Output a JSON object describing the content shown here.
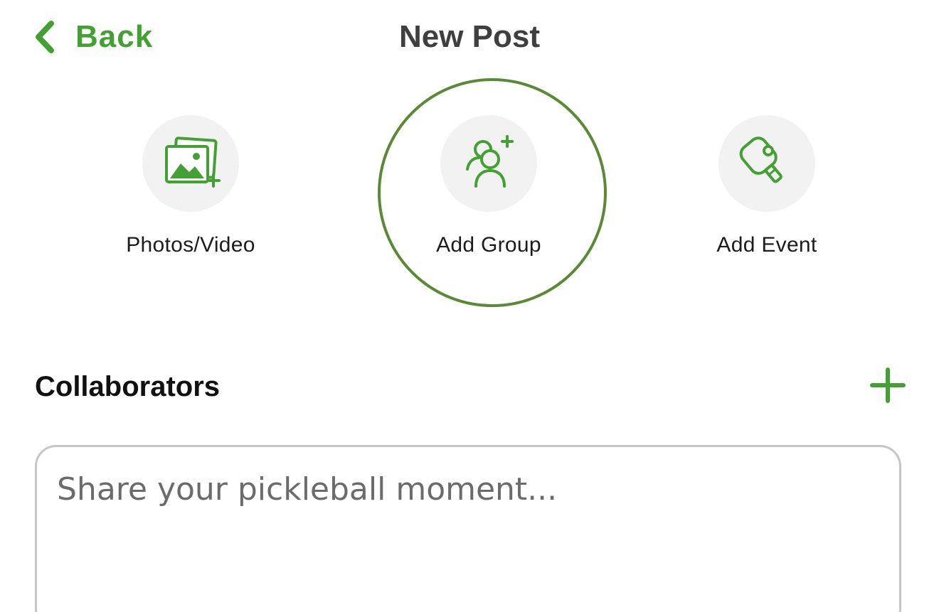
{
  "header": {
    "back_label": "Back",
    "title": "New Post"
  },
  "actions": [
    {
      "label": "Photos/Video",
      "icon": "photo-gallery-add-icon",
      "selected": false
    },
    {
      "label": "Add Group",
      "icon": "add-user-icon",
      "selected": true
    },
    {
      "label": "Add Event",
      "icon": "pickleball-paddle-icon",
      "selected": false
    }
  ],
  "collaborators": {
    "title": "Collaborators",
    "add_icon": "plus-icon"
  },
  "composer": {
    "placeholder": "Share your pickleball moment...",
    "value": ""
  },
  "colors": {
    "accent": "#43a032",
    "selected_ring": "#5a8a35",
    "icon_bg": "#f2f2f2",
    "title_text": "#3f3f3f",
    "border": "#c6c6c6"
  }
}
